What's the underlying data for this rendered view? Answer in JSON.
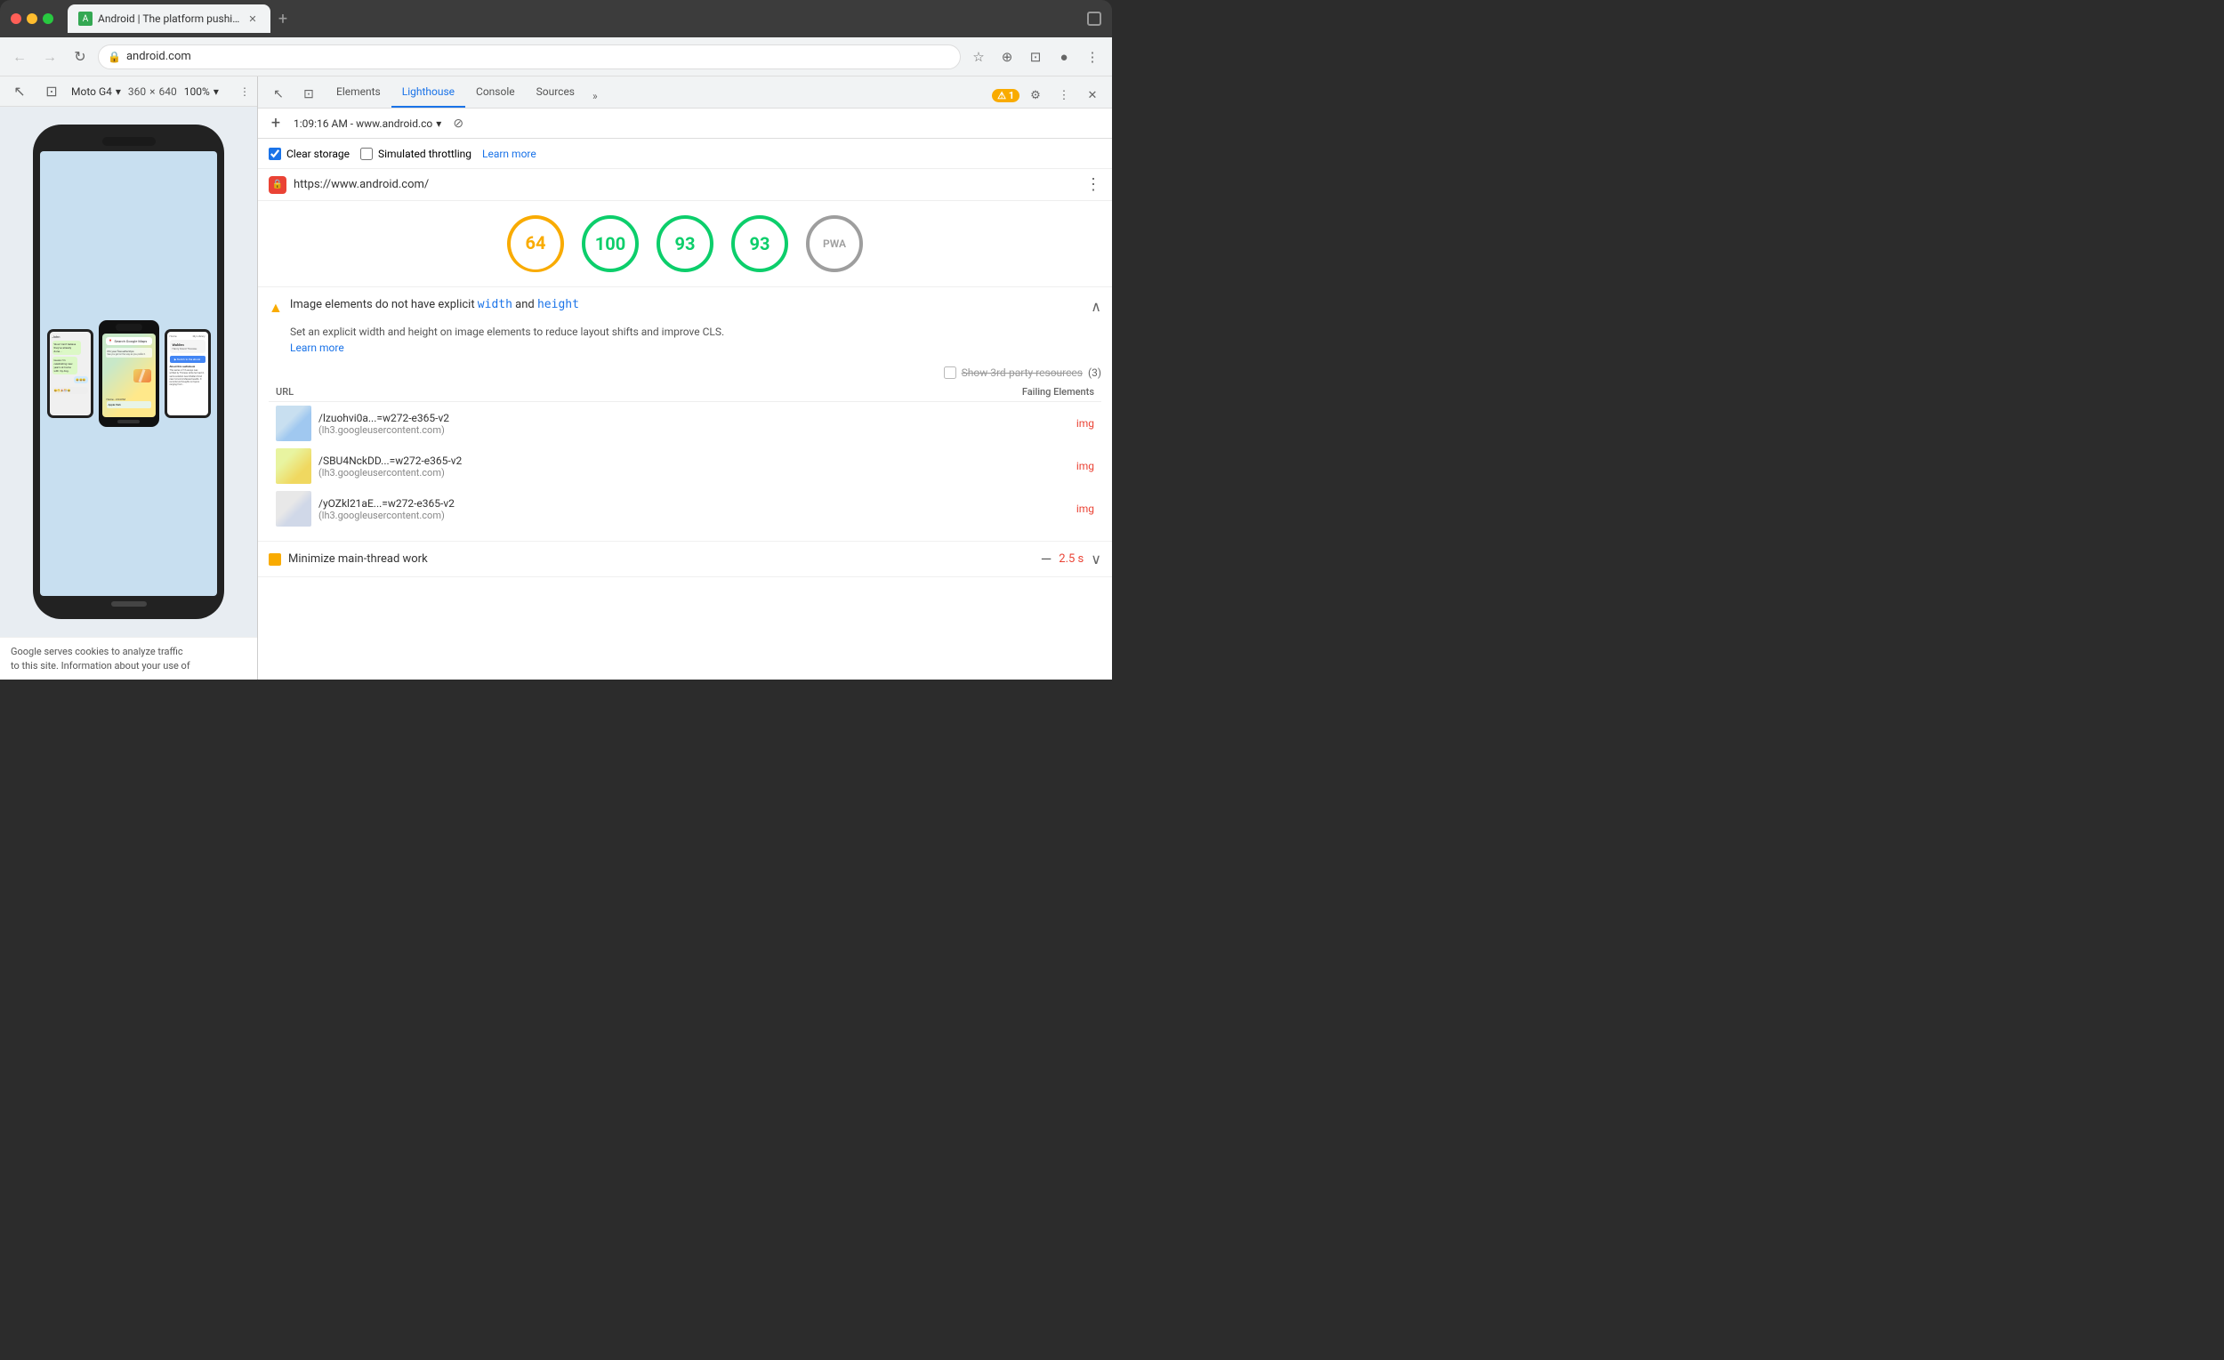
{
  "browser": {
    "tab_title": "Android | The platform pushing",
    "tab_favicon_letter": "A",
    "new_tab_label": "+",
    "address": "android.com",
    "address_full": "https://www.android.com/",
    "window_expand_icon": "⛶"
  },
  "nav": {
    "back_icon": "←",
    "forward_icon": "→",
    "reload_icon": "↻",
    "address_text": "android.com",
    "lock_icon": "🔒",
    "star_icon": "☆",
    "extension_icon": "⊕",
    "cast_icon": "⊡",
    "profile_icon": "●",
    "menu_icon": "⋮"
  },
  "device_toolbar": {
    "device_name": "Moto G4",
    "device_icon": "▾",
    "width": "360",
    "cross": "×",
    "height": "640",
    "zoom": "100%",
    "zoom_icon": "▾",
    "more_icon": "⋮",
    "cursor_icon": "↖",
    "mobile_icon": "⊡",
    "separator_more": "⋮"
  },
  "devtools": {
    "elements_tab": "Elements",
    "lighthouse_tab": "Lighthouse",
    "console_tab": "Console",
    "sources_tab": "Sources",
    "more_tabs_icon": "»",
    "warning_count": "1",
    "settings_icon": "⚙",
    "kebab_icon": "⋮",
    "close_icon": "✕",
    "pointer_icon": "↖",
    "mobile_icon": "⊡"
  },
  "lighthouse": {
    "add_icon": "+",
    "session_time": "1:09:16 AM - www.android.co",
    "session_dropdown_icon": "▾",
    "clear_icon": "⊘",
    "clear_storage_label": "Clear storage",
    "simulated_throttling_label": "Simulated throttling",
    "learn_more_label": "Learn more",
    "audit_url": "https://www.android.com/",
    "audit_more_icon": "⋮",
    "audit_warning_icon": "⚠",
    "audit_collapse_icon": "∧",
    "audit_expand_icon": "∨"
  },
  "scores": [
    {
      "value": "64",
      "type": "orange",
      "active": true
    },
    {
      "value": "100",
      "type": "green",
      "active": false
    },
    {
      "value": "93",
      "type": "green",
      "active": false
    },
    {
      "value": "93",
      "type": "green",
      "active": false
    },
    {
      "value": "PWA",
      "type": "gray",
      "active": false
    }
  ],
  "audit_item": {
    "warning_icon": "▲",
    "title_prefix": "Image elements do not have explicit ",
    "width_code": "width",
    "and_text": " and ",
    "height_code": "height",
    "description": "Set an explicit width and height on image elements to reduce layout shifts and improve CLS.",
    "learn_more_text": "Learn more",
    "show_third_party_label": "Show 3rd-party resources",
    "third_party_count": "(3)",
    "col_url": "URL",
    "col_failing": "Failing Elements"
  },
  "table_rows": [
    {
      "url": "/lzuohvi0a...=w272-e365-v2",
      "domain": "(lh3.googleusercontent.com)",
      "failing": "img",
      "thumb_class": "url-thumb-1"
    },
    {
      "url": "/SBU4NckDD...=w272-e365-v2",
      "domain": "(lh3.googleusercontent.com)",
      "failing": "img",
      "thumb_class": "url-thumb-2"
    },
    {
      "url": "/yOZkl21aE...=w272-e365-v2",
      "domain": "(lh3.googleusercontent.com)",
      "failing": "img",
      "thumb_class": "url-thumb-3"
    }
  ],
  "minimize_work": {
    "icon_color": "#f9ab00",
    "title": "Minimize main-thread work",
    "dash": "—",
    "time": "2.5 s",
    "expand_icon": "∨"
  },
  "webpage_footer": {
    "text_line1": "Google serves cookies to analyze traffic",
    "text_line2": "to this site. Information about your use of"
  }
}
